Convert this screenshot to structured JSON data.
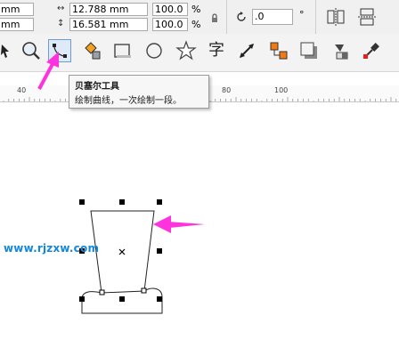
{
  "property_bar": {
    "x_unit_fragment": "mm",
    "y_unit_fragment": "mm",
    "width_value": "12.788 mm",
    "height_value": "16.581 mm",
    "scale_x": "100.0",
    "scale_y": "100.0",
    "percent_symbol": "%",
    "rotation_value": ".0",
    "degree_symbol": "°"
  },
  "toolbox": {
    "items": [
      {
        "name": "shape-tool-icon",
        "active": false
      },
      {
        "name": "zoom-tool-icon",
        "active": false
      },
      {
        "name": "bezier-tool-icon",
        "active": true
      },
      {
        "name": "smart-fill-tool-icon",
        "active": false
      },
      {
        "name": "rectangle-tool-icon",
        "active": false
      },
      {
        "name": "ellipse-tool-icon",
        "active": false
      },
      {
        "name": "star-tool-icon",
        "active": false
      },
      {
        "name": "text-tool-icon",
        "active": false
      },
      {
        "name": "dimension-tool-icon",
        "active": false
      },
      {
        "name": "connector-tool-icon",
        "active": false
      },
      {
        "name": "drop-shadow-tool-icon",
        "active": false
      },
      {
        "name": "transparency-tool-icon",
        "active": false
      },
      {
        "name": "eyedropper-tool-icon",
        "active": false
      }
    ],
    "text_tool_glyph": "字"
  },
  "tooltip": {
    "title": "贝塞尔工具",
    "description": "绘制曲线，一次绘制一段。"
  },
  "ruler": {
    "labels": [
      "40",
      "80",
      "100"
    ]
  },
  "watermark": "www.rjzxw.com",
  "colors": {
    "arrow_pink": "#ff33dd",
    "watermark_blue": "#1687d9",
    "active_tool_border": "#6e9cd0",
    "node_black": "#000000"
  }
}
